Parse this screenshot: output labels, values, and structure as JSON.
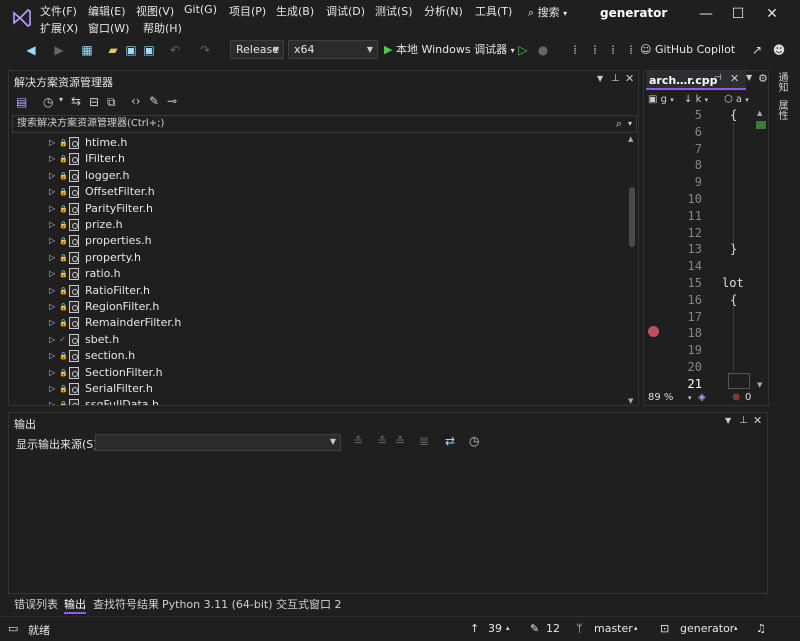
{
  "menu": {
    "row1": [
      "文件(F)",
      "编辑(E)",
      "视图(V)",
      "Git(G)",
      "项目(P)",
      "生成(B)",
      "调试(D)",
      "测试(S)",
      "分析(N)",
      "工具(T)"
    ],
    "row2": [
      "扩展(X)",
      "窗口(W)",
      "帮助(H)"
    ],
    "search_label": "搜索",
    "solution_name": "generator"
  },
  "window_controls": {
    "minimize": "—",
    "maximize": "☐",
    "close": "✕"
  },
  "toolbar": {
    "config": "Release",
    "platform": "x64",
    "run_label": "本地 Windows 调试器",
    "copilot_label": "GitHub Copilot"
  },
  "solution_explorer": {
    "title": "解决方案资源管理器",
    "search_placeholder": "搜索解决方案资源管理器(Ctrl+;)",
    "files": [
      {
        "name": "htime.h",
        "status": "lock"
      },
      {
        "name": "IFilter.h",
        "status": "lock"
      },
      {
        "name": "logger.h",
        "status": "lock"
      },
      {
        "name": "OffsetFilter.h",
        "status": "lock"
      },
      {
        "name": "ParityFilter.h",
        "status": "lock"
      },
      {
        "name": "prize.h",
        "status": "lock"
      },
      {
        "name": "properties.h",
        "status": "lock"
      },
      {
        "name": "property.h",
        "status": "lock"
      },
      {
        "name": "ratio.h",
        "status": "lock"
      },
      {
        "name": "RatioFilter.h",
        "status": "lock"
      },
      {
        "name": "RegionFilter.h",
        "status": "lock"
      },
      {
        "name": "RemainderFilter.h",
        "status": "lock"
      },
      {
        "name": "sbet.h",
        "status": "check"
      },
      {
        "name": "section.h",
        "status": "lock"
      },
      {
        "name": "SectionFilter.h",
        "status": "lock"
      },
      {
        "name": "SerialFilter.h",
        "status": "lock"
      },
      {
        "name": "ssqFullData.h",
        "status": "lock"
      }
    ]
  },
  "editor": {
    "tab_title": "arch…r.cpp",
    "nav_left": "g",
    "nav_mid": "k",
    "nav_right": "a",
    "line_numbers": [
      "5",
      "6",
      "7",
      "8",
      "9",
      "10",
      "11",
      "12",
      "13",
      "14",
      "15",
      "16",
      "17",
      "18",
      "19",
      "20",
      "21"
    ],
    "code_lines": [
      {
        "line": "5",
        "text": "{"
      },
      {
        "line": "13",
        "text": "}"
      },
      {
        "line": "15",
        "text": "lot"
      },
      {
        "line": "16",
        "text": "{"
      }
    ],
    "zoom": "89 %",
    "error_count": "0"
  },
  "vertical_tabs": [
    "通知",
    "属性"
  ],
  "output": {
    "title": "输出",
    "source_label": "显示输出来源(S):",
    "source_value": ""
  },
  "bottom_tabs": [
    "错误列表",
    "输出",
    "查找符号结果",
    "Python 3.11 (64-bit) 交互式窗口 2"
  ],
  "statusbar": {
    "ready": "就绪",
    "line_count": "39",
    "change_count": "12",
    "branch": "master",
    "repo": "generator"
  }
}
